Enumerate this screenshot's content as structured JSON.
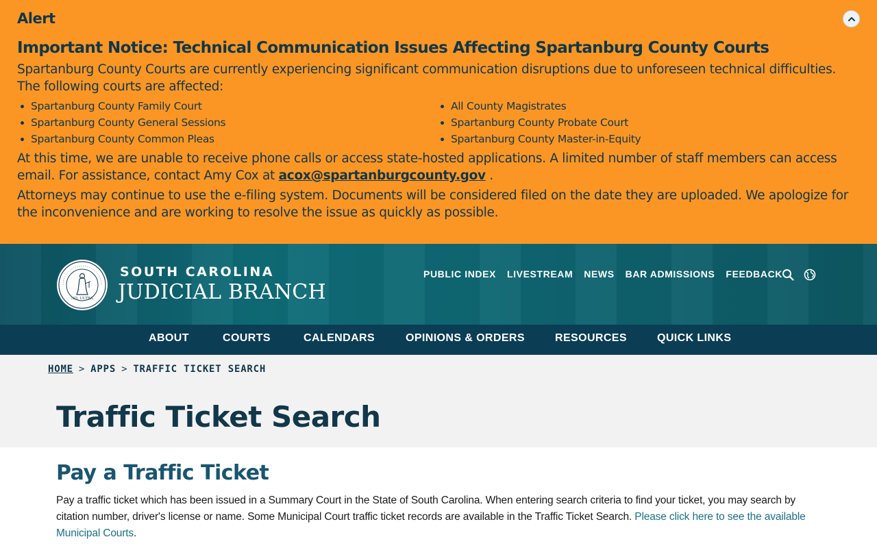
{
  "alert": {
    "label": "Alert",
    "title": "Important Notice: Technical Communication Issues Affecting Spartanburg County Courts",
    "intro": "Spartanburg County Courts are currently experiencing significant communication disruptions due to unforeseen technical difficulties. The following courts are affected:",
    "courts_left": [
      "Spartanburg County Family Court",
      "Spartanburg County General Sessions",
      "Spartanburg County Common Pleas"
    ],
    "courts_right": [
      "All County Magistrates",
      "Spartanburg County Probate Court",
      "Spartanburg County Master-in-Equity"
    ],
    "para2_text": "At this time, we are unable to receive phone calls or access state-hosted applications. A limited number of staff members can access email. For assistance, contact Amy Cox at",
    "para2_email": "acox@spartanburgcounty.gov",
    "para2_end": ".",
    "para3": "Attorneys may continue to use the e-filing system. Documents will be considered filed on the date they are uploaded. We apologize for the inconvenience and are working to resolve the issue as quickly as possible.",
    "toggle_icon": "chevron-up-icon"
  },
  "header": {
    "brand_top": "SOUTH CAROLINA",
    "brand_bottom": "JUDICIAL BRANCH",
    "seal_text": "NIL ULTRA",
    "util_links": [
      "PUBLIC INDEX",
      "LIVESTREAM",
      "NEWS",
      "BAR ADMISSIONS",
      "FEEDBACK"
    ],
    "icons": [
      "search-icon",
      "globe-icon"
    ]
  },
  "nav": {
    "items": [
      "ABOUT",
      "COURTS",
      "CALENDARS",
      "OPINIONS & ORDERS",
      "RESOURCES",
      "QUICK LINKS"
    ]
  },
  "breadcrumb": {
    "items": [
      "HOME",
      "APPS",
      "TRAFFIC TICKET SEARCH"
    ],
    "separator": ">"
  },
  "page": {
    "title": "Traffic Ticket Search",
    "section_title": "Pay a Traffic Ticket",
    "section_text": "Pay a traffic ticket which has been issued in a Summary Court in the State of South Carolina. When entering search criteria to find your ticket, you may search by citation number, driver's license or name. Some Municipal Court traffic ticket records are available in the Traffic Ticket Search.",
    "section_link": "Please click here to see the available Municipal Courts",
    "section_end": "."
  },
  "colors": {
    "alert_bg": "#fb9624",
    "header_teal": "#0f6d78",
    "nav_navy": "#0b3d55",
    "title_navy": "#11374a",
    "link_teal": "#1b6f86"
  }
}
